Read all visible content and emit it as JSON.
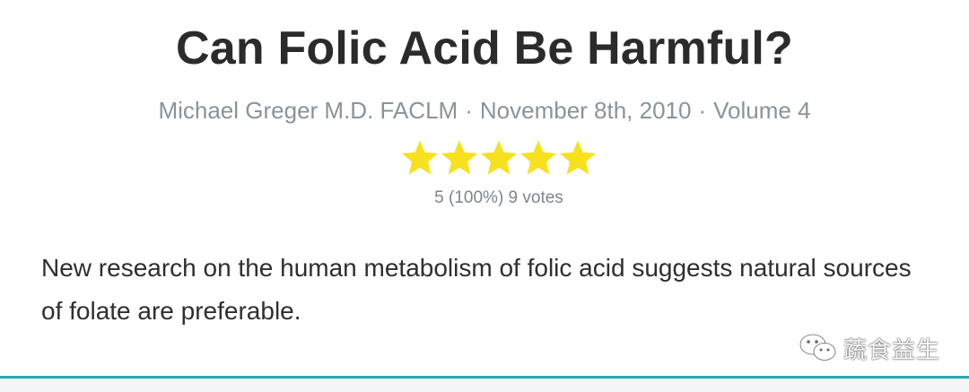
{
  "article": {
    "title": "Can Folic Acid Be Harmful?",
    "author": "Michael Greger M.D. FACLM",
    "date": "November 8th, 2010",
    "volume": "Volume 4",
    "separator": "·",
    "summary": "New research on the human metabolism of folic acid suggests natural sources of folate are preferable."
  },
  "rating": {
    "stars_filled": 5,
    "stars_total": 5,
    "label": "5 (100%) 9 votes",
    "icon": "star-icon",
    "star_color": "#f7e11e"
  },
  "watermark": {
    "icon": "wechat-icon",
    "text": "蔬食益生"
  },
  "colors": {
    "accent": "#27a7b6",
    "title": "#2b2b2b",
    "meta": "#8a939c"
  }
}
